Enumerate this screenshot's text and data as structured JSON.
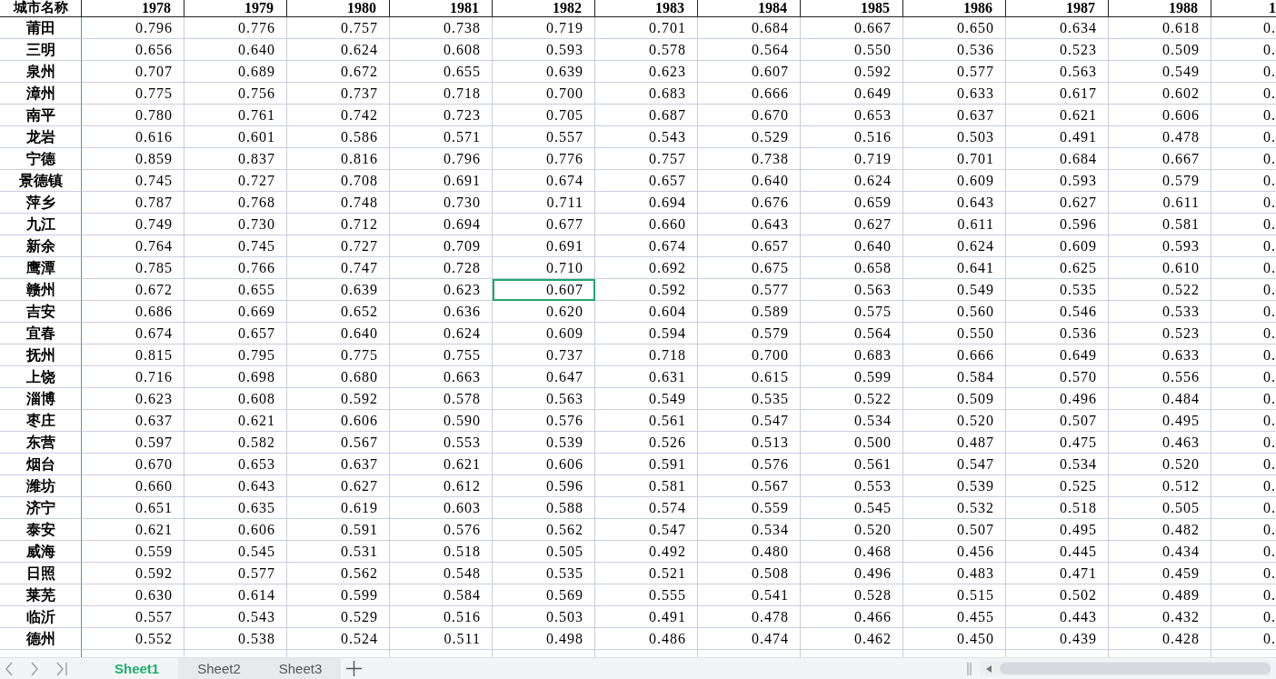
{
  "sheet": {
    "columns": [
      "城市名称",
      "1978",
      "1979",
      "1980",
      "1981",
      "1982",
      "1983",
      "1984",
      "1985",
      "1986",
      "1987",
      "1988",
      "1"
    ],
    "rows": [
      {
        "cells": [
          {
            "text": "莆田",
            "selected": false
          },
          {
            "text": "0.796",
            "selected": false
          },
          {
            "text": "0.776",
            "selected": false
          },
          {
            "text": "0.757",
            "selected": false
          },
          {
            "text": "0.738",
            "selected": false
          },
          {
            "text": "0.719",
            "selected": false
          },
          {
            "text": "0.701",
            "selected": false
          },
          {
            "text": "0.684",
            "selected": false
          },
          {
            "text": "0.667",
            "selected": false
          },
          {
            "text": "0.650",
            "selected": false
          },
          {
            "text": "0.634",
            "selected": false
          },
          {
            "text": "0.618",
            "selected": false
          },
          {
            "text": "0.",
            "selected": false
          }
        ]
      },
      {
        "cells": [
          {
            "text": "三明",
            "selected": false
          },
          {
            "text": "0.656",
            "selected": false
          },
          {
            "text": "0.640",
            "selected": false
          },
          {
            "text": "0.624",
            "selected": false
          },
          {
            "text": "0.608",
            "selected": false
          },
          {
            "text": "0.593",
            "selected": false
          },
          {
            "text": "0.578",
            "selected": false
          },
          {
            "text": "0.564",
            "selected": false
          },
          {
            "text": "0.550",
            "selected": false
          },
          {
            "text": "0.536",
            "selected": false
          },
          {
            "text": "0.523",
            "selected": false
          },
          {
            "text": "0.509",
            "selected": false
          },
          {
            "text": "0.",
            "selected": false
          }
        ]
      },
      {
        "cells": [
          {
            "text": "泉州",
            "selected": false
          },
          {
            "text": "0.707",
            "selected": false
          },
          {
            "text": "0.689",
            "selected": false
          },
          {
            "text": "0.672",
            "selected": false
          },
          {
            "text": "0.655",
            "selected": false
          },
          {
            "text": "0.639",
            "selected": false
          },
          {
            "text": "0.623",
            "selected": false
          },
          {
            "text": "0.607",
            "selected": false
          },
          {
            "text": "0.592",
            "selected": false
          },
          {
            "text": "0.577",
            "selected": false
          },
          {
            "text": "0.563",
            "selected": false
          },
          {
            "text": "0.549",
            "selected": false
          },
          {
            "text": "0.",
            "selected": false
          }
        ]
      },
      {
        "cells": [
          {
            "text": "漳州",
            "selected": false
          },
          {
            "text": "0.775",
            "selected": false
          },
          {
            "text": "0.756",
            "selected": false
          },
          {
            "text": "0.737",
            "selected": false
          },
          {
            "text": "0.718",
            "selected": false
          },
          {
            "text": "0.700",
            "selected": false
          },
          {
            "text": "0.683",
            "selected": false
          },
          {
            "text": "0.666",
            "selected": false
          },
          {
            "text": "0.649",
            "selected": false
          },
          {
            "text": "0.633",
            "selected": false
          },
          {
            "text": "0.617",
            "selected": false
          },
          {
            "text": "0.602",
            "selected": false
          },
          {
            "text": "0.",
            "selected": false
          }
        ]
      },
      {
        "cells": [
          {
            "text": "南平",
            "selected": false
          },
          {
            "text": "0.780",
            "selected": false
          },
          {
            "text": "0.761",
            "selected": false
          },
          {
            "text": "0.742",
            "selected": false
          },
          {
            "text": "0.723",
            "selected": false
          },
          {
            "text": "0.705",
            "selected": false
          },
          {
            "text": "0.687",
            "selected": false
          },
          {
            "text": "0.670",
            "selected": false
          },
          {
            "text": "0.653",
            "selected": false
          },
          {
            "text": "0.637",
            "selected": false
          },
          {
            "text": "0.621",
            "selected": false
          },
          {
            "text": "0.606",
            "selected": false
          },
          {
            "text": "0.",
            "selected": false
          }
        ]
      },
      {
        "cells": [
          {
            "text": "龙岩",
            "selected": false
          },
          {
            "text": "0.616",
            "selected": false
          },
          {
            "text": "0.601",
            "selected": false
          },
          {
            "text": "0.586",
            "selected": false
          },
          {
            "text": "0.571",
            "selected": false
          },
          {
            "text": "0.557",
            "selected": false
          },
          {
            "text": "0.543",
            "selected": false
          },
          {
            "text": "0.529",
            "selected": false
          },
          {
            "text": "0.516",
            "selected": false
          },
          {
            "text": "0.503",
            "selected": false
          },
          {
            "text": "0.491",
            "selected": false
          },
          {
            "text": "0.478",
            "selected": false
          },
          {
            "text": "0.",
            "selected": false
          }
        ]
      },
      {
        "cells": [
          {
            "text": "宁德",
            "selected": false
          },
          {
            "text": "0.859",
            "selected": false
          },
          {
            "text": "0.837",
            "selected": false
          },
          {
            "text": "0.816",
            "selected": false
          },
          {
            "text": "0.796",
            "selected": false
          },
          {
            "text": "0.776",
            "selected": false
          },
          {
            "text": "0.757",
            "selected": false
          },
          {
            "text": "0.738",
            "selected": false
          },
          {
            "text": "0.719",
            "selected": false
          },
          {
            "text": "0.701",
            "selected": false
          },
          {
            "text": "0.684",
            "selected": false
          },
          {
            "text": "0.667",
            "selected": false
          },
          {
            "text": "0.",
            "selected": false
          }
        ]
      },
      {
        "cells": [
          {
            "text": "景德镇",
            "selected": false
          },
          {
            "text": "0.745",
            "selected": false
          },
          {
            "text": "0.727",
            "selected": false
          },
          {
            "text": "0.708",
            "selected": false
          },
          {
            "text": "0.691",
            "selected": false
          },
          {
            "text": "0.674",
            "selected": false
          },
          {
            "text": "0.657",
            "selected": false
          },
          {
            "text": "0.640",
            "selected": false
          },
          {
            "text": "0.624",
            "selected": false
          },
          {
            "text": "0.609",
            "selected": false
          },
          {
            "text": "0.593",
            "selected": false
          },
          {
            "text": "0.579",
            "selected": false
          },
          {
            "text": "0.",
            "selected": false
          }
        ]
      },
      {
        "cells": [
          {
            "text": "萍乡",
            "selected": false
          },
          {
            "text": "0.787",
            "selected": false
          },
          {
            "text": "0.768",
            "selected": false
          },
          {
            "text": "0.748",
            "selected": false
          },
          {
            "text": "0.730",
            "selected": false
          },
          {
            "text": "0.711",
            "selected": false
          },
          {
            "text": "0.694",
            "selected": false
          },
          {
            "text": "0.676",
            "selected": false
          },
          {
            "text": "0.659",
            "selected": false
          },
          {
            "text": "0.643",
            "selected": false
          },
          {
            "text": "0.627",
            "selected": false
          },
          {
            "text": "0.611",
            "selected": false
          },
          {
            "text": "0.",
            "selected": false
          }
        ]
      },
      {
        "cells": [
          {
            "text": "九江",
            "selected": false
          },
          {
            "text": "0.749",
            "selected": false
          },
          {
            "text": "0.730",
            "selected": false
          },
          {
            "text": "0.712",
            "selected": false
          },
          {
            "text": "0.694",
            "selected": false
          },
          {
            "text": "0.677",
            "selected": false
          },
          {
            "text": "0.660",
            "selected": false
          },
          {
            "text": "0.643",
            "selected": false
          },
          {
            "text": "0.627",
            "selected": false
          },
          {
            "text": "0.611",
            "selected": false
          },
          {
            "text": "0.596",
            "selected": false
          },
          {
            "text": "0.581",
            "selected": false
          },
          {
            "text": "0.",
            "selected": false
          }
        ]
      },
      {
        "cells": [
          {
            "text": "新余",
            "selected": false
          },
          {
            "text": "0.764",
            "selected": false
          },
          {
            "text": "0.745",
            "selected": false
          },
          {
            "text": "0.727",
            "selected": false
          },
          {
            "text": "0.709",
            "selected": false
          },
          {
            "text": "0.691",
            "selected": false
          },
          {
            "text": "0.674",
            "selected": false
          },
          {
            "text": "0.657",
            "selected": false
          },
          {
            "text": "0.640",
            "selected": false
          },
          {
            "text": "0.624",
            "selected": false
          },
          {
            "text": "0.609",
            "selected": false
          },
          {
            "text": "0.593",
            "selected": false
          },
          {
            "text": "0.",
            "selected": false
          }
        ]
      },
      {
        "cells": [
          {
            "text": "鹰潭",
            "selected": false
          },
          {
            "text": "0.785",
            "selected": false
          },
          {
            "text": "0.766",
            "selected": false
          },
          {
            "text": "0.747",
            "selected": false
          },
          {
            "text": "0.728",
            "selected": false
          },
          {
            "text": "0.710",
            "selected": false
          },
          {
            "text": "0.692",
            "selected": false
          },
          {
            "text": "0.675",
            "selected": false
          },
          {
            "text": "0.658",
            "selected": false
          },
          {
            "text": "0.641",
            "selected": false
          },
          {
            "text": "0.625",
            "selected": false
          },
          {
            "text": "0.610",
            "selected": false
          },
          {
            "text": "0.",
            "selected": false
          }
        ]
      },
      {
        "cells": [
          {
            "text": "赣州",
            "selected": false
          },
          {
            "text": "0.672",
            "selected": false
          },
          {
            "text": "0.655",
            "selected": false
          },
          {
            "text": "0.639",
            "selected": false
          },
          {
            "text": "0.623",
            "selected": false
          },
          {
            "text": "0.607",
            "selected": true
          },
          {
            "text": "0.592",
            "selected": false
          },
          {
            "text": "0.577",
            "selected": false
          },
          {
            "text": "0.563",
            "selected": false
          },
          {
            "text": "0.549",
            "selected": false
          },
          {
            "text": "0.535",
            "selected": false
          },
          {
            "text": "0.522",
            "selected": false
          },
          {
            "text": "0.",
            "selected": false
          }
        ]
      },
      {
        "cells": [
          {
            "text": "吉安",
            "selected": false
          },
          {
            "text": "0.686",
            "selected": false
          },
          {
            "text": "0.669",
            "selected": false
          },
          {
            "text": "0.652",
            "selected": false
          },
          {
            "text": "0.636",
            "selected": false
          },
          {
            "text": "0.620",
            "selected": false
          },
          {
            "text": "0.604",
            "selected": false
          },
          {
            "text": "0.589",
            "selected": false
          },
          {
            "text": "0.575",
            "selected": false
          },
          {
            "text": "0.560",
            "selected": false
          },
          {
            "text": "0.546",
            "selected": false
          },
          {
            "text": "0.533",
            "selected": false
          },
          {
            "text": "0.",
            "selected": false
          }
        ]
      },
      {
        "cells": [
          {
            "text": "宜春",
            "selected": false
          },
          {
            "text": "0.674",
            "selected": false
          },
          {
            "text": "0.657",
            "selected": false
          },
          {
            "text": "0.640",
            "selected": false
          },
          {
            "text": "0.624",
            "selected": false
          },
          {
            "text": "0.609",
            "selected": false
          },
          {
            "text": "0.594",
            "selected": false
          },
          {
            "text": "0.579",
            "selected": false
          },
          {
            "text": "0.564",
            "selected": false
          },
          {
            "text": "0.550",
            "selected": false
          },
          {
            "text": "0.536",
            "selected": false
          },
          {
            "text": "0.523",
            "selected": false
          },
          {
            "text": "0.",
            "selected": false
          }
        ]
      },
      {
        "cells": [
          {
            "text": "抚州",
            "selected": false
          },
          {
            "text": "0.815",
            "selected": false
          },
          {
            "text": "0.795",
            "selected": false
          },
          {
            "text": "0.775",
            "selected": false
          },
          {
            "text": "0.755",
            "selected": false
          },
          {
            "text": "0.737",
            "selected": false
          },
          {
            "text": "0.718",
            "selected": false
          },
          {
            "text": "0.700",
            "selected": false
          },
          {
            "text": "0.683",
            "selected": false
          },
          {
            "text": "0.666",
            "selected": false
          },
          {
            "text": "0.649",
            "selected": false
          },
          {
            "text": "0.633",
            "selected": false
          },
          {
            "text": "0.",
            "selected": false
          }
        ]
      },
      {
        "cells": [
          {
            "text": "上饶",
            "selected": false
          },
          {
            "text": "0.716",
            "selected": false
          },
          {
            "text": "0.698",
            "selected": false
          },
          {
            "text": "0.680",
            "selected": false
          },
          {
            "text": "0.663",
            "selected": false
          },
          {
            "text": "0.647",
            "selected": false
          },
          {
            "text": "0.631",
            "selected": false
          },
          {
            "text": "0.615",
            "selected": false
          },
          {
            "text": "0.599",
            "selected": false
          },
          {
            "text": "0.584",
            "selected": false
          },
          {
            "text": "0.570",
            "selected": false
          },
          {
            "text": "0.556",
            "selected": false
          },
          {
            "text": "0.",
            "selected": false
          }
        ]
      },
      {
        "cells": [
          {
            "text": "淄博",
            "selected": false
          },
          {
            "text": "0.623",
            "selected": false
          },
          {
            "text": "0.608",
            "selected": false
          },
          {
            "text": "0.592",
            "selected": false
          },
          {
            "text": "0.578",
            "selected": false
          },
          {
            "text": "0.563",
            "selected": false
          },
          {
            "text": "0.549",
            "selected": false
          },
          {
            "text": "0.535",
            "selected": false
          },
          {
            "text": "0.522",
            "selected": false
          },
          {
            "text": "0.509",
            "selected": false
          },
          {
            "text": "0.496",
            "selected": false
          },
          {
            "text": "0.484",
            "selected": false
          },
          {
            "text": "0.",
            "selected": false
          }
        ]
      },
      {
        "cells": [
          {
            "text": "枣庄",
            "selected": false
          },
          {
            "text": "0.637",
            "selected": false
          },
          {
            "text": "0.621",
            "selected": false
          },
          {
            "text": "0.606",
            "selected": false
          },
          {
            "text": "0.590",
            "selected": false
          },
          {
            "text": "0.576",
            "selected": false
          },
          {
            "text": "0.561",
            "selected": false
          },
          {
            "text": "0.547",
            "selected": false
          },
          {
            "text": "0.534",
            "selected": false
          },
          {
            "text": "0.520",
            "selected": false
          },
          {
            "text": "0.507",
            "selected": false
          },
          {
            "text": "0.495",
            "selected": false
          },
          {
            "text": "0.",
            "selected": false
          }
        ]
      },
      {
        "cells": [
          {
            "text": "东营",
            "selected": false
          },
          {
            "text": "0.597",
            "selected": false
          },
          {
            "text": "0.582",
            "selected": false
          },
          {
            "text": "0.567",
            "selected": false
          },
          {
            "text": "0.553",
            "selected": false
          },
          {
            "text": "0.539",
            "selected": false
          },
          {
            "text": "0.526",
            "selected": false
          },
          {
            "text": "0.513",
            "selected": false
          },
          {
            "text": "0.500",
            "selected": false
          },
          {
            "text": "0.487",
            "selected": false
          },
          {
            "text": "0.475",
            "selected": false
          },
          {
            "text": "0.463",
            "selected": false
          },
          {
            "text": "0.",
            "selected": false
          }
        ]
      },
      {
        "cells": [
          {
            "text": "烟台",
            "selected": false
          },
          {
            "text": "0.670",
            "selected": false
          },
          {
            "text": "0.653",
            "selected": false
          },
          {
            "text": "0.637",
            "selected": false
          },
          {
            "text": "0.621",
            "selected": false
          },
          {
            "text": "0.606",
            "selected": false
          },
          {
            "text": "0.591",
            "selected": false
          },
          {
            "text": "0.576",
            "selected": false
          },
          {
            "text": "0.561",
            "selected": false
          },
          {
            "text": "0.547",
            "selected": false
          },
          {
            "text": "0.534",
            "selected": false
          },
          {
            "text": "0.520",
            "selected": false
          },
          {
            "text": "0.",
            "selected": false
          }
        ]
      },
      {
        "cells": [
          {
            "text": "潍坊",
            "selected": false
          },
          {
            "text": "0.660",
            "selected": false
          },
          {
            "text": "0.643",
            "selected": false
          },
          {
            "text": "0.627",
            "selected": false
          },
          {
            "text": "0.612",
            "selected": false
          },
          {
            "text": "0.596",
            "selected": false
          },
          {
            "text": "0.581",
            "selected": false
          },
          {
            "text": "0.567",
            "selected": false
          },
          {
            "text": "0.553",
            "selected": false
          },
          {
            "text": "0.539",
            "selected": false
          },
          {
            "text": "0.525",
            "selected": false
          },
          {
            "text": "0.512",
            "selected": false
          },
          {
            "text": "0.",
            "selected": false
          }
        ]
      },
      {
        "cells": [
          {
            "text": "济宁",
            "selected": false
          },
          {
            "text": "0.651",
            "selected": false
          },
          {
            "text": "0.635",
            "selected": false
          },
          {
            "text": "0.619",
            "selected": false
          },
          {
            "text": "0.603",
            "selected": false
          },
          {
            "text": "0.588",
            "selected": false
          },
          {
            "text": "0.574",
            "selected": false
          },
          {
            "text": "0.559",
            "selected": false
          },
          {
            "text": "0.545",
            "selected": false
          },
          {
            "text": "0.532",
            "selected": false
          },
          {
            "text": "0.518",
            "selected": false
          },
          {
            "text": "0.505",
            "selected": false
          },
          {
            "text": "0.",
            "selected": false
          }
        ]
      },
      {
        "cells": [
          {
            "text": "泰安",
            "selected": false
          },
          {
            "text": "0.621",
            "selected": false
          },
          {
            "text": "0.606",
            "selected": false
          },
          {
            "text": "0.591",
            "selected": false
          },
          {
            "text": "0.576",
            "selected": false
          },
          {
            "text": "0.562",
            "selected": false
          },
          {
            "text": "0.547",
            "selected": false
          },
          {
            "text": "0.534",
            "selected": false
          },
          {
            "text": "0.520",
            "selected": false
          },
          {
            "text": "0.507",
            "selected": false
          },
          {
            "text": "0.495",
            "selected": false
          },
          {
            "text": "0.482",
            "selected": false
          },
          {
            "text": "0.",
            "selected": false
          }
        ]
      },
      {
        "cells": [
          {
            "text": "威海",
            "selected": false
          },
          {
            "text": "0.559",
            "selected": false
          },
          {
            "text": "0.545",
            "selected": false
          },
          {
            "text": "0.531",
            "selected": false
          },
          {
            "text": "0.518",
            "selected": false
          },
          {
            "text": "0.505",
            "selected": false
          },
          {
            "text": "0.492",
            "selected": false
          },
          {
            "text": "0.480",
            "selected": false
          },
          {
            "text": "0.468",
            "selected": false
          },
          {
            "text": "0.456",
            "selected": false
          },
          {
            "text": "0.445",
            "selected": false
          },
          {
            "text": "0.434",
            "selected": false
          },
          {
            "text": "0.",
            "selected": false
          }
        ]
      },
      {
        "cells": [
          {
            "text": "日照",
            "selected": false
          },
          {
            "text": "0.592",
            "selected": false
          },
          {
            "text": "0.577",
            "selected": false
          },
          {
            "text": "0.562",
            "selected": false
          },
          {
            "text": "0.548",
            "selected": false
          },
          {
            "text": "0.535",
            "selected": false
          },
          {
            "text": "0.521",
            "selected": false
          },
          {
            "text": "0.508",
            "selected": false
          },
          {
            "text": "0.496",
            "selected": false
          },
          {
            "text": "0.483",
            "selected": false
          },
          {
            "text": "0.471",
            "selected": false
          },
          {
            "text": "0.459",
            "selected": false
          },
          {
            "text": "0.",
            "selected": false
          }
        ]
      },
      {
        "cells": [
          {
            "text": "莱芜",
            "selected": false
          },
          {
            "text": "0.630",
            "selected": false
          },
          {
            "text": "0.614",
            "selected": false
          },
          {
            "text": "0.599",
            "selected": false
          },
          {
            "text": "0.584",
            "selected": false
          },
          {
            "text": "0.569",
            "selected": false
          },
          {
            "text": "0.555",
            "selected": false
          },
          {
            "text": "0.541",
            "selected": false
          },
          {
            "text": "0.528",
            "selected": false
          },
          {
            "text": "0.515",
            "selected": false
          },
          {
            "text": "0.502",
            "selected": false
          },
          {
            "text": "0.489",
            "selected": false
          },
          {
            "text": "0.",
            "selected": false
          }
        ]
      },
      {
        "cells": [
          {
            "text": "临沂",
            "selected": false
          },
          {
            "text": "0.557",
            "selected": false
          },
          {
            "text": "0.543",
            "selected": false
          },
          {
            "text": "0.529",
            "selected": false
          },
          {
            "text": "0.516",
            "selected": false
          },
          {
            "text": "0.503",
            "selected": false
          },
          {
            "text": "0.491",
            "selected": false
          },
          {
            "text": "0.478",
            "selected": false
          },
          {
            "text": "0.466",
            "selected": false
          },
          {
            "text": "0.455",
            "selected": false
          },
          {
            "text": "0.443",
            "selected": false
          },
          {
            "text": "0.432",
            "selected": false
          },
          {
            "text": "0.",
            "selected": false
          }
        ]
      },
      {
        "cells": [
          {
            "text": "德州",
            "selected": false
          },
          {
            "text": "0.552",
            "selected": false
          },
          {
            "text": "0.538",
            "selected": false
          },
          {
            "text": "0.524",
            "selected": false
          },
          {
            "text": "0.511",
            "selected": false
          },
          {
            "text": "0.498",
            "selected": false
          },
          {
            "text": "0.486",
            "selected": false
          },
          {
            "text": "0.474",
            "selected": false
          },
          {
            "text": "0.462",
            "selected": false
          },
          {
            "text": "0.450",
            "selected": false
          },
          {
            "text": "0.439",
            "selected": false
          },
          {
            "text": "0.428",
            "selected": false
          },
          {
            "text": "0.",
            "selected": false
          }
        ]
      }
    ]
  },
  "sheet_tabs": [
    {
      "label": "Sheet1",
      "selected": true
    },
    {
      "label": "Sheet2",
      "selected": false
    },
    {
      "label": "Sheet3",
      "selected": false
    }
  ]
}
